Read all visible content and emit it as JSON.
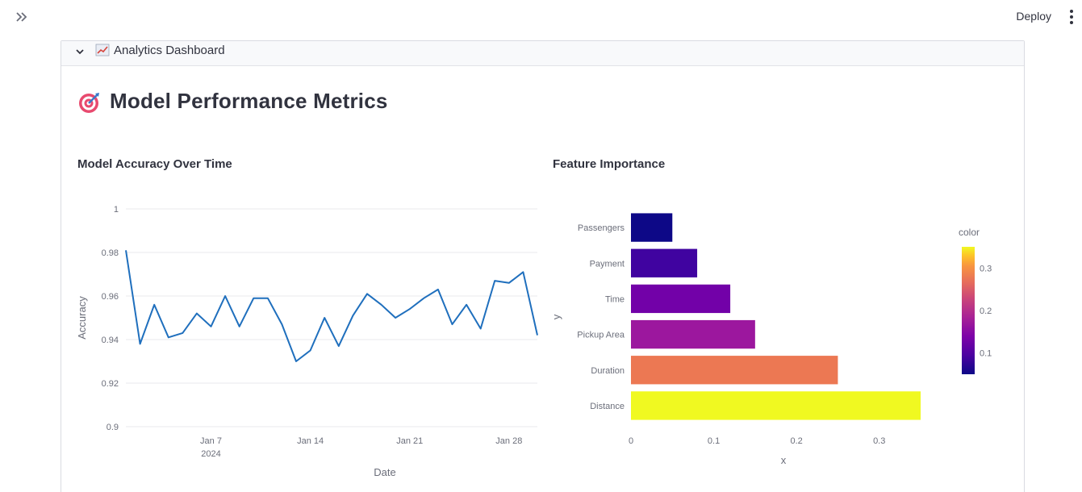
{
  "app": {
    "deploy_label": "Deploy",
    "sidebar_toggle_icon": "double-chevron-right-icon",
    "menu_icon": "kebab-menu-icon"
  },
  "expander": {
    "icon": "chart-increasing-icon",
    "label": "Analytics Dashboard",
    "expanded": true
  },
  "page": {
    "title": "Model Performance Metrics",
    "title_icon": "direct-hit-target-icon"
  },
  "colors": {
    "line": "#1f6fbd",
    "grid": "#e8eaee",
    "axis_text": "#6b6e7a"
  },
  "chart_data": [
    {
      "type": "line",
      "title": "Model Accuracy Over Time",
      "xlabel": "Date",
      "ylabel": "Accuracy",
      "ylim": [
        0.9,
        1.0
      ],
      "yticks": [
        "0.9",
        "0.92",
        "0.94",
        "0.96",
        "0.98",
        "1"
      ],
      "xticks": [
        "Jan 7",
        "Jan 14",
        "Jan 21",
        "Jan 28"
      ],
      "xtick_year": "2024",
      "grid": true,
      "x": [
        "2024-01-01",
        "2024-01-02",
        "2024-01-03",
        "2024-01-04",
        "2024-01-05",
        "2024-01-06",
        "2024-01-07",
        "2024-01-08",
        "2024-01-09",
        "2024-01-10",
        "2024-01-11",
        "2024-01-12",
        "2024-01-13",
        "2024-01-14",
        "2024-01-15",
        "2024-01-16",
        "2024-01-17",
        "2024-01-18",
        "2024-01-19",
        "2024-01-20",
        "2024-01-21",
        "2024-01-22",
        "2024-01-23",
        "2024-01-24",
        "2024-01-25",
        "2024-01-26",
        "2024-01-27",
        "2024-01-28",
        "2024-01-29",
        "2024-01-30"
      ],
      "values": [
        0.981,
        0.938,
        0.956,
        0.941,
        0.943,
        0.952,
        0.946,
        0.96,
        0.946,
        0.959,
        0.959,
        0.947,
        0.93,
        0.935,
        0.95,
        0.937,
        0.951,
        0.961,
        0.956,
        0.95,
        0.954,
        0.959,
        0.963,
        0.947,
        0.956,
        0.945,
        0.967,
        0.966,
        0.971,
        0.942
      ]
    },
    {
      "type": "bar",
      "orientation": "horizontal",
      "title": "Feature Importance",
      "xlabel": "x",
      "ylabel": "y",
      "xlim": [
        0,
        0.35
      ],
      "xticks": [
        "0",
        "0.1",
        "0.2",
        "0.3"
      ],
      "categories": [
        "Passengers",
        "Payment",
        "Time",
        "Pickup Area",
        "Duration",
        "Distance"
      ],
      "values": [
        0.05,
        0.08,
        0.12,
        0.15,
        0.25,
        0.35
      ],
      "bar_colors": [
        "#0d0887",
        "#4003a0",
        "#7201a8",
        "#9c179e",
        "#ec7853",
        "#f0f921"
      ],
      "colorbar": {
        "title": "color",
        "ticks": [
          "0.1",
          "0.2",
          "0.3"
        ],
        "range": [
          0.05,
          0.35
        ],
        "colormap": "plasma"
      }
    }
  ]
}
